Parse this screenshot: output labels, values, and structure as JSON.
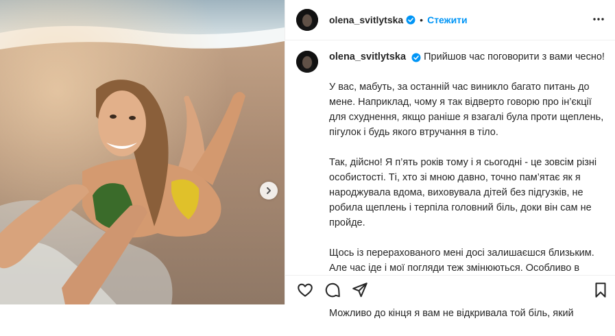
{
  "post": {
    "username": "olena_svitlytska",
    "follow_label": "Стежити",
    "separator": "•",
    "caption_first_line": "Прийшов час поговорити з вами чесно!",
    "paragraphs": [
      "У вас, мабуть, за останній час виникло багато питань до мене. Наприклад, чому я так відверто говорю про ін’єкції для схуднення, якщо раніше я взагалі була проти щеплень, пігулок і будь якого втручання в тіло.",
      "Так, дійсно! Я п’ять років тому і я сьогодні - це зовсім різні особистості. Ті, хто зі мною давно, точно пам’ятає як я народжувала вдома, виховувала дітей без підгузків, не робила щеплень і терпіла головний біль, доки він сам не пройде.",
      "Щось із перерахованого мені досі залишаєш­ся близьким. Але час іде і мої погляди теж змінюються. Особливо в світлі останніх подій в моєму житті.",
      "Можливо до кінця я вам не відкривала той біль, який"
    ]
  },
  "icons": {
    "verified": "verified-badge-icon",
    "more": "more-options-icon",
    "like": "heart-icon",
    "comment": "comment-icon",
    "share": "share-icon",
    "save": "bookmark-icon",
    "next": "chevron-right-icon"
  },
  "colors": {
    "accent": "#0095f6",
    "text": "#262626"
  }
}
